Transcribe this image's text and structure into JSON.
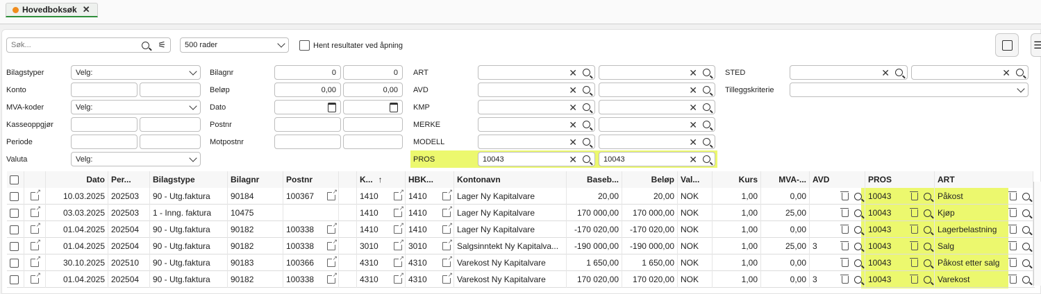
{
  "tab": {
    "label": "Hovedboksøk",
    "close": "✕"
  },
  "search": {
    "placeholder": "Søk...",
    "rows": "500 rader",
    "fetch_on_open": "Hent resultater ved åpning"
  },
  "filters": {
    "bilagstyper": {
      "label": "Bilagstyper",
      "value": "Velg:"
    },
    "konto": {
      "label": "Konto"
    },
    "mva": {
      "label": "MVA-koder",
      "value": "Velg:"
    },
    "kasse": {
      "label": "Kasseoppgjør"
    },
    "periode": {
      "label": "Periode"
    },
    "valuta": {
      "label": "Valuta",
      "value": "Velg:"
    },
    "bilagnr": {
      "label": "Bilagnr",
      "from": "0",
      "to": "0"
    },
    "belop": {
      "label": "Beløp",
      "from": "0,00",
      "to": "0,00"
    },
    "dato": {
      "label": "Dato"
    },
    "postnr": {
      "label": "Postnr"
    },
    "motpostnr": {
      "label": "Motpostnr"
    },
    "art": {
      "label": "ART"
    },
    "avd": {
      "label": "AVD"
    },
    "kmp": {
      "label": "KMP"
    },
    "merke": {
      "label": "MERKE"
    },
    "modell": {
      "label": "MODELL"
    },
    "pros": {
      "label": "PROS",
      "from": "10043",
      "to": "10043"
    },
    "sted": {
      "label": "STED"
    },
    "tillegg": {
      "label": "Tilleggskriterie"
    }
  },
  "columns": [
    "Dato",
    "Per...",
    "Bilagstype",
    "Bilagnr",
    "Postnr",
    "K...",
    "HBK...",
    "Kontonavn",
    "Baseb...",
    "Beløp",
    "Val...",
    "Kurs",
    "MVA-...",
    "AVD",
    "PROS",
    "ART"
  ],
  "sort_arrow": "↑",
  "rows": [
    {
      "dato": "10.03.2025",
      "per": "202503",
      "type": "90 - Utg.faktura",
      "bilagnr": "90184",
      "postnr": "100367",
      "k": "1410",
      "hbk": "1410",
      "navn": "Lager Ny Kapitalvare",
      "base": "20,00",
      "belop": "20,00",
      "val": "NOK",
      "kurs": "1,00",
      "mva": "0,00",
      "avd": "",
      "pros": "10043",
      "art": "Påkost"
    },
    {
      "dato": "03.03.2025",
      "per": "202503",
      "type": "1 - Inng. faktura",
      "bilagnr": "10475",
      "postnr": "",
      "k": "1410",
      "hbk": "1410",
      "navn": "Lager Ny Kapitalvare",
      "base": "170 000,00",
      "belop": "170 000,00",
      "val": "NOK",
      "kurs": "1,00",
      "mva": "25,00",
      "avd": "",
      "pros": "10043",
      "art": "Kjøp"
    },
    {
      "dato": "01.04.2025",
      "per": "202504",
      "type": "90 - Utg.faktura",
      "bilagnr": "90182",
      "postnr": "100338",
      "k": "1410",
      "hbk": "1410",
      "navn": "Lager Ny Kapitalvare",
      "base": "-170 020,00",
      "belop": "-170 020,00",
      "val": "NOK",
      "kurs": "1,00",
      "mva": "0,00",
      "avd": "",
      "pros": "10043",
      "art": "Lagerbelastning"
    },
    {
      "dato": "01.04.2025",
      "per": "202504",
      "type": "90 - Utg.faktura",
      "bilagnr": "90182",
      "postnr": "100338",
      "k": "3010",
      "hbk": "3010",
      "navn": "Salgsinntekt Ny Kapitalva...",
      "base": "-190 000,00",
      "belop": "-190 000,00",
      "val": "NOK",
      "kurs": "1,00",
      "mva": "25,00",
      "avd": "3",
      "pros": "10043",
      "art": "Salg"
    },
    {
      "dato": "30.10.2025",
      "per": "202510",
      "type": "90 - Utg.faktura",
      "bilagnr": "90183",
      "postnr": "100366",
      "k": "4310",
      "hbk": "4310",
      "navn": "Varekost Ny Kapitalvare",
      "base": "1 650,00",
      "belop": "1 650,00",
      "val": "NOK",
      "kurs": "1,00",
      "mva": "0,00",
      "avd": "",
      "pros": "10043",
      "art": "Påkost etter salg"
    },
    {
      "dato": "01.04.2025",
      "per": "202504",
      "type": "90 - Utg.faktura",
      "bilagnr": "90182",
      "postnr": "100338",
      "k": "4310",
      "hbk": "4310",
      "navn": "Varekost Ny Kapitalvare",
      "base": "170 020,00",
      "belop": "170 020,00",
      "val": "NOK",
      "kurs": "1,00",
      "mva": "0,00",
      "avd": "3",
      "pros": "10043",
      "art": "Varekost"
    }
  ],
  "colors": {
    "highlight": "#ecf86e",
    "tab_accent": "#2f8f3a",
    "tab_dot": "#f08c1d"
  }
}
